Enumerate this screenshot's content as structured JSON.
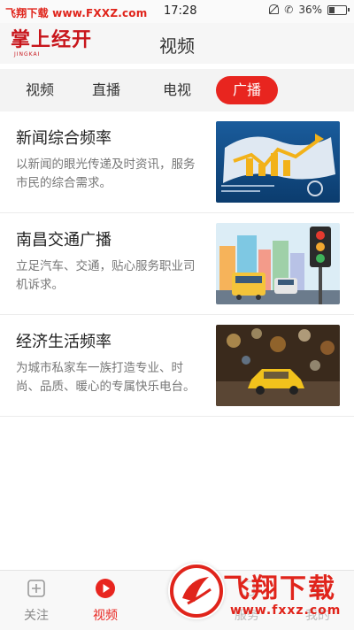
{
  "status_bar": {
    "watermark": "飞翔下载 www.FXXZ.com",
    "time": "17:28",
    "battery_percent": "36%",
    "battery_level": 0.36,
    "icons": [
      "bell-muted-icon",
      "phone-wifi-icon",
      "battery-icon"
    ]
  },
  "header": {
    "logo_text": "掌上经开",
    "logo_sub": "JINGKAI",
    "title": "视频"
  },
  "tabs": [
    {
      "label": "视频",
      "active": false
    },
    {
      "label": "直播",
      "active": false
    },
    {
      "label": "电视",
      "active": false
    },
    {
      "label": "广播",
      "active": true
    }
  ],
  "programs": [
    {
      "title": "新闻综合频率",
      "desc": "以新闻的眼光传递及时资讯，服务市民的综合需求。",
      "thumb": "business-growth-chart-image"
    },
    {
      "title": "南昌交通广播",
      "desc": "立足汽车、交通，贴心服务职业司机诉求。",
      "thumb": "traffic-light-city-image"
    },
    {
      "title": "经济生活频率",
      "desc": "为城市私家车一族打造专业、时尚、品质、暖心的专属快乐电台。",
      "thumb": "night-taxi-bokeh-image"
    }
  ],
  "bottom_nav": [
    {
      "label": "关注",
      "icon": "plus-square-icon",
      "active": false
    },
    {
      "label": "视频",
      "icon": "play-circle-icon",
      "active": true
    },
    {
      "label": "服务",
      "icon": "service-icon",
      "active": false
    },
    {
      "label": "我的",
      "icon": "user-icon",
      "active": false
    }
  ],
  "watermark": {
    "text": "飞翔下载",
    "url": "www.fxxz.com"
  },
  "colors": {
    "accent": "#e8251f",
    "brand": "#c8151b"
  }
}
